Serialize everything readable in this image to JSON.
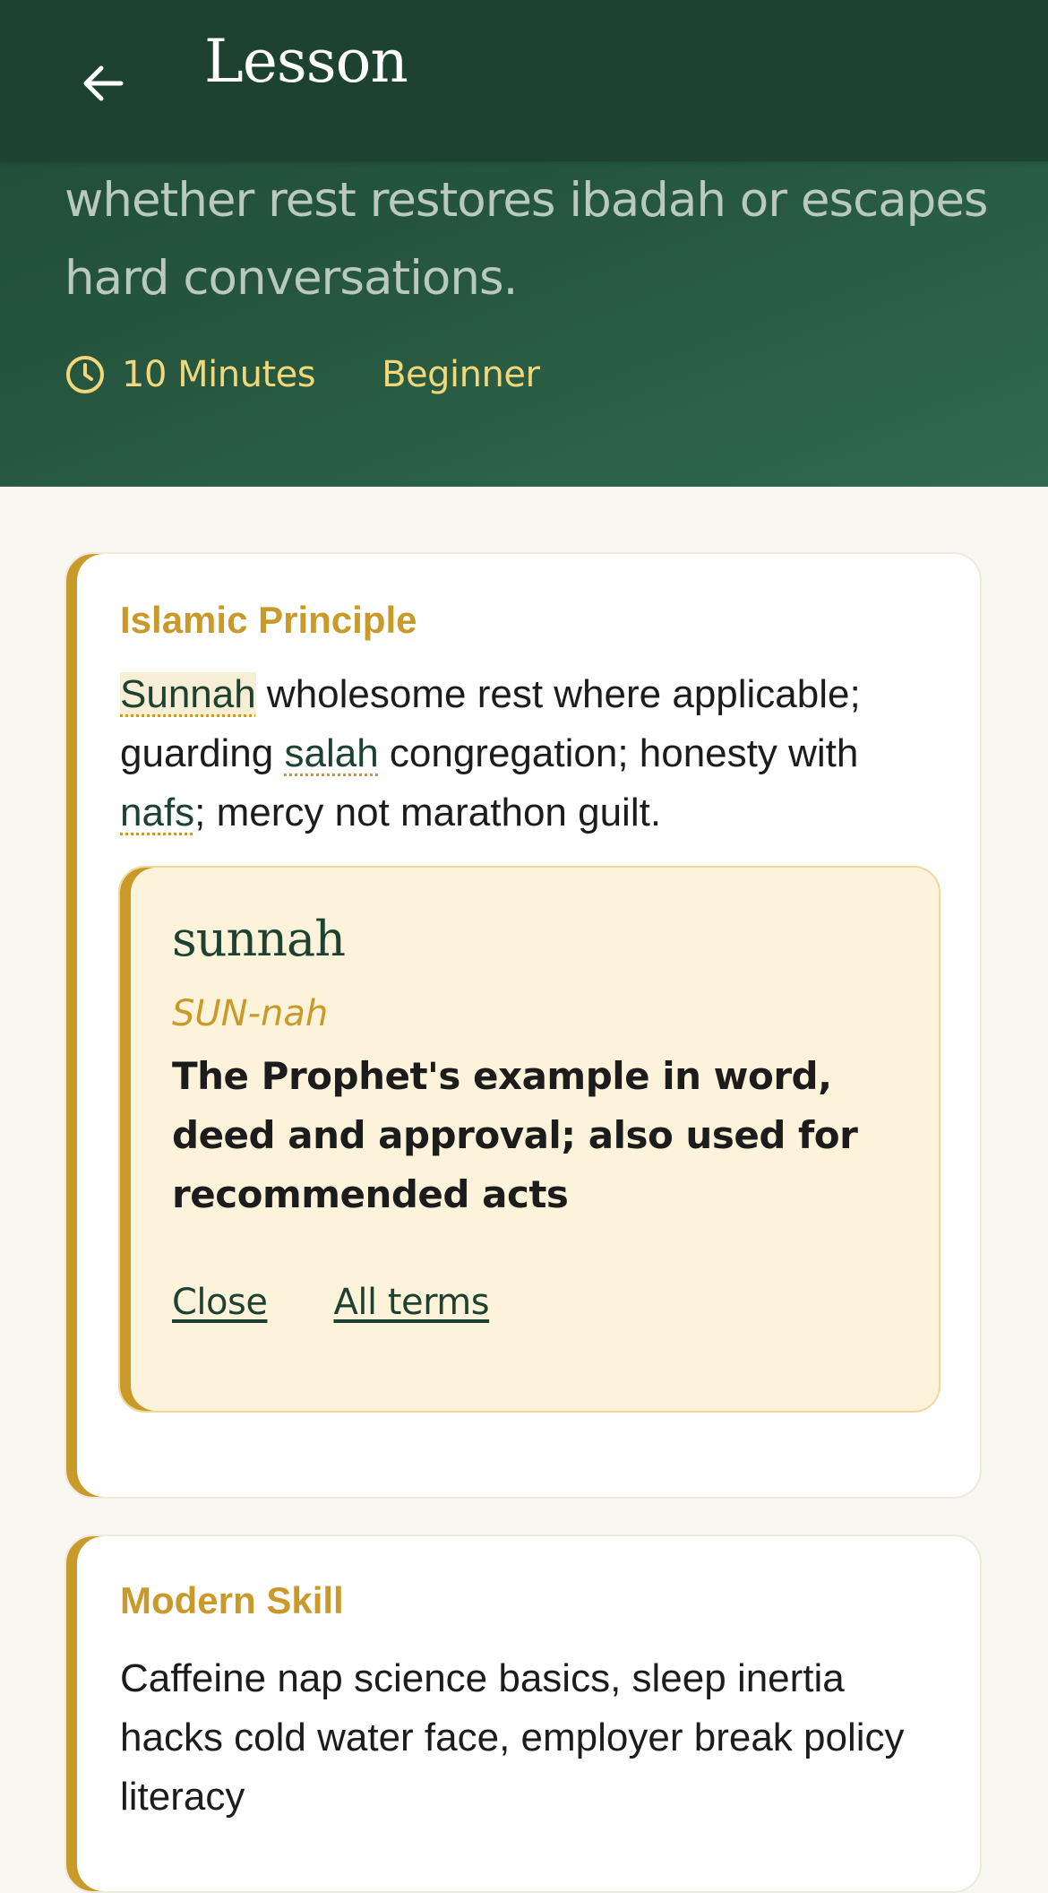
{
  "header": {
    "title": "Lesson",
    "back_icon": "arrow-left-icon"
  },
  "hero": {
    "description": "whether rest restores ibadah or escapes hard conversations.",
    "duration": "10 Minutes",
    "duration_icon": "clock-icon",
    "level": "Beginner"
  },
  "colors": {
    "header": "#1d4232",
    "hero_gradient_start": "#1f4a36",
    "hero_gradient_end": "#2f6a4e",
    "accent_gold": "#c99a2a",
    "meta_text": "#f1d77a",
    "page_background": "#f8f6f0",
    "popover_background": "#fcf3da"
  },
  "cards": [
    {
      "label": "Islamic Principle",
      "body": {
        "term1": "Sunnah",
        "text1": " wholesome rest where applicable; guarding ",
        "term2": "salah",
        "text2": " congregation; honesty with ",
        "term3": "nafs",
        "text3": "; mercy not marathon guilt."
      },
      "popover": {
        "term": "sunnah",
        "pronunciation": "SUN-nah",
        "definition": "The Prophet's example in word, deed and approval; also used for recommended acts",
        "close_label": "Close",
        "all_terms_label": "All terms"
      }
    },
    {
      "label": "Modern Skill",
      "body": "Caffeine nap science basics, sleep inertia hacks cold water face, employer break policy literacy"
    }
  ]
}
